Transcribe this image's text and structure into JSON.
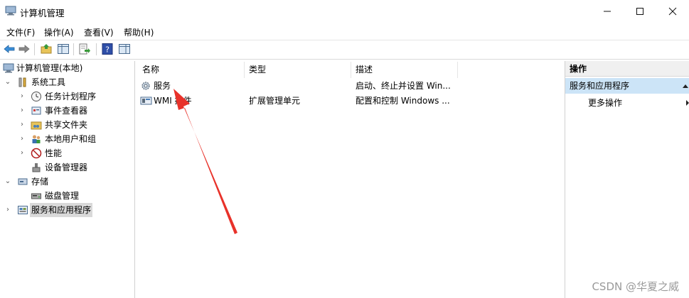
{
  "window": {
    "title": "计算机管理",
    "minimize_icon": "minimize-icon",
    "maximize_icon": "maximize-icon",
    "close_icon": "close-icon"
  },
  "menu": [
    "文件(F)",
    "操作(A)",
    "查看(V)",
    "帮助(H)"
  ],
  "toolbar": {
    "icons": [
      "back-arrow-icon",
      "forward-arrow-icon",
      "up-folder-icon",
      "show-hide-tree-icon",
      "export-list-icon",
      "help-icon",
      "properties-icon"
    ]
  },
  "tree": {
    "items": [
      {
        "label": "计算机管理(本地)",
        "icon": "computer-management-icon"
      },
      {
        "label": "系统工具",
        "icon": "tools-icon",
        "expander": "⌄"
      },
      {
        "label": "任务计划程序",
        "icon": "clock-icon",
        "expander": "›"
      },
      {
        "label": "事件查看器",
        "icon": "event-viewer-icon",
        "expander": "›"
      },
      {
        "label": "共享文件夹",
        "icon": "shared-folder-icon",
        "expander": "›"
      },
      {
        "label": "本地用户和组",
        "icon": "users-icon",
        "expander": "›"
      },
      {
        "label": "性能",
        "icon": "performance-icon",
        "expander": "›"
      },
      {
        "label": "设备管理器",
        "icon": "device-manager-icon"
      },
      {
        "label": "存储",
        "icon": "storage-icon",
        "expander": "⌄"
      },
      {
        "label": "磁盘管理",
        "icon": "disk-icon"
      },
      {
        "label": "服务和应用程序",
        "icon": "services-apps-icon",
        "expander": "›"
      }
    ]
  },
  "list": {
    "columns": [
      "名称",
      "类型",
      "描述"
    ],
    "rows": [
      {
        "name": "服务",
        "type": "",
        "description": "启动、终止并设置 Win...",
        "icon": "gear-icon"
      },
      {
        "name": "WMI 控件",
        "type": "扩展管理单元",
        "description": "配置和控制 Windows ...",
        "icon": "wmi-control-icon"
      }
    ]
  },
  "actions": {
    "header": "操作",
    "section": "服务和应用程序",
    "items": [
      "更多操作"
    ],
    "collapse_icon": "collapse-up-icon",
    "submenu_icon": "more-arrow-icon"
  },
  "annotation": {
    "arrow_color": "#e8322a"
  },
  "watermark": "CSDN @华夏之威"
}
